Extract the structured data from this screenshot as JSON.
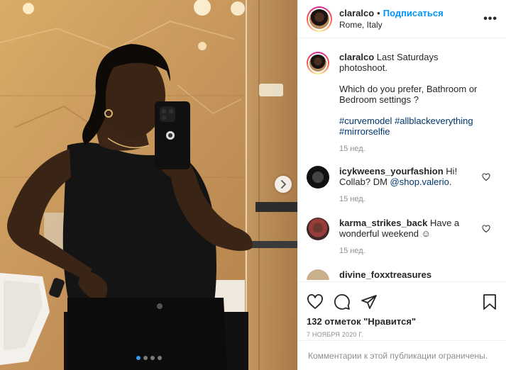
{
  "post": {
    "username": "claralco",
    "follow_label": "Подписаться",
    "separator": "•",
    "location": "Rome, Italy",
    "more_label": "•••"
  },
  "caption": {
    "username": "claralco",
    "line1": "Last Saturdays photoshoot.",
    "line2": "Which do you prefer, Bathroom or Bedroom settings ?",
    "tags": [
      "#curvemodel",
      "#allblackeverything",
      "#mirrorselfie"
    ],
    "time": "15 нед."
  },
  "comments": [
    {
      "username": "icykweens_yourfashion",
      "text": "Hi! Collab? DM ",
      "mention": "@shop.valerio",
      "tail": ".",
      "time": "15 нед."
    },
    {
      "username": "karma_strikes_back",
      "text": "Have a wonderful weekend ☺",
      "time": "15 нед."
    },
    {
      "username": "divine_foxxtreasures",
      "text": "",
      "time": ""
    }
  ],
  "actions": {
    "likes": "132 отметок \"Нравится\"",
    "date": "7 НОЯБРЯ 2020 Г.",
    "restricted": "Комментарии к этой публикации ограничены."
  },
  "carousel": {
    "count": 4,
    "active": 0
  },
  "colors": {
    "follow": "#0095f6",
    "tag": "#00376b",
    "muted": "#8e8e8e",
    "dot_active": "#3897f0"
  },
  "icons": [
    "next-arrow-icon",
    "more-icon",
    "heart-icon",
    "comment-icon",
    "share-icon",
    "bookmark-icon"
  ]
}
